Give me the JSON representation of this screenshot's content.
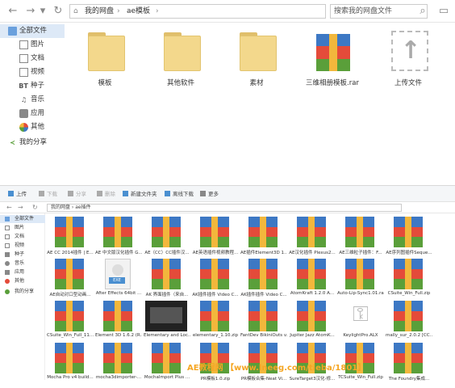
{
  "top": {
    "breadcrumb": {
      "root": "我的网盘",
      "sep": "›",
      "folder": "ae模板"
    },
    "search_placeholder": "搜索我的网盘文件",
    "sidebar": [
      {
        "label": "全部文件",
        "icon": "folder-icon"
      },
      {
        "label": "图片",
        "icon": "image-icon"
      },
      {
        "label": "文档",
        "icon": "document-icon"
      },
      {
        "label": "视频",
        "icon": "video-icon"
      },
      {
        "label": "种子",
        "icon": "bt-icon",
        "badge": "BT"
      },
      {
        "label": "音乐",
        "icon": "music-icon"
      },
      {
        "label": "应用",
        "icon": "app-icon"
      },
      {
        "label": "其他",
        "icon": "other-icon"
      },
      {
        "label": "我的分享",
        "icon": "share-icon"
      }
    ],
    "files": [
      {
        "name": "模板",
        "type": "folder"
      },
      {
        "name": "其他软件",
        "type": "folder"
      },
      {
        "name": "素材",
        "type": "folder"
      },
      {
        "name": "三维相册模板.rar",
        "type": "rar"
      },
      {
        "name": "上传文件",
        "type": "upload"
      }
    ],
    "colors": {
      "accent": "#3d78c4",
      "folder": "#f3d88c"
    }
  },
  "bottom": {
    "toolbar": [
      "上传",
      "下载",
      "分享",
      "删除",
      "新建文件夹",
      "离线下载",
      "更多"
    ],
    "breadcrumb": "我的网盘  ›  ae插件",
    "sidebar": [
      "全部文件",
      "图片",
      "文档",
      "视频",
      "种子",
      "音乐",
      "应用",
      "其他",
      "我的分享"
    ],
    "files": [
      {
        "name": "AE CC 2014插件 | E...",
        "type": "rar"
      },
      {
        "name": "AE 中文版汉化插件 G...",
        "type": "rar"
      },
      {
        "name": "AE（CC）CC插件汉...",
        "type": "rar"
      },
      {
        "name": "AE英语插件视频教程...",
        "type": "rar"
      },
      {
        "name": "AE插件Element3D 1...",
        "type": "rar"
      },
      {
        "name": "AE汉化插件 Plexus2...",
        "type": "rar"
      },
      {
        "name": "AE三维粒子插件：F...",
        "type": "rar"
      },
      {
        "name": "AE序列图插件Seque...",
        "type": "rar"
      },
      {
        "name": "AE自动对口型动画...",
        "type": "rar"
      },
      {
        "name": "After Effects 64bit ...",
        "type": "exe"
      },
      {
        "name": "AK 界面插件（来自...",
        "type": "rar"
      },
      {
        "name": "AK插件插件 Video C...",
        "type": "rar"
      },
      {
        "name": "AK插件插件 Video C...",
        "type": "rar"
      },
      {
        "name": "AtomKraft 1.2.0 A...",
        "type": "rar"
      },
      {
        "name": "Auto-Lip-Sync1.01.rar",
        "type": "rar"
      },
      {
        "name": "CSuite_Win_Full.zip",
        "type": "rar"
      },
      {
        "name": "CSuite_Win_Full_11...",
        "type": "rar"
      },
      {
        "name": "Element 3D 1.6.2 (R...",
        "type": "rar"
      },
      {
        "name": "Elementary and Loc...",
        "type": "thumb"
      },
      {
        "name": "elementary_1.10.zip",
        "type": "rar"
      },
      {
        "name": "FantDev BikiniOuts v...",
        "type": "rar"
      },
      {
        "name": "Jupiter Jazz AtomK...",
        "type": "rar"
      },
      {
        "name": "KeylightPro.ALX",
        "type": "key"
      },
      {
        "name": "mally_sur_2.0.2 [CC...",
        "type": "rar"
      },
      {
        "name": "Mocha Pro v4 build...",
        "type": "rar"
      },
      {
        "name": "mocha3dimporter-...",
        "type": "rar"
      },
      {
        "name": "MochaImport Plus ...",
        "type": "rar"
      },
      {
        "name": "PR模板1.0.zip",
        "type": "rar"
      },
      {
        "name": "PR模板合集-Neat Vi...",
        "type": "rar"
      },
      {
        "name": "SureTarget3汉化-修...",
        "type": "rar"
      },
      {
        "name": "TCSuite_Win_Full.zip",
        "type": "rar"
      },
      {
        "name": "The Foundry集成...",
        "type": "rar"
      }
    ]
  },
  "watermark": "AE教程网 【www.lneeg.com/tieba/1801】"
}
